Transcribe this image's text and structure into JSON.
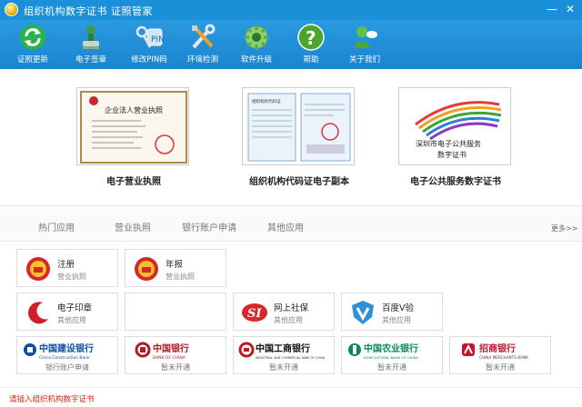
{
  "window": {
    "title": "组织机构数字证书  证照管家",
    "minimize": "—",
    "close": "✕"
  },
  "toolbar": {
    "items": [
      {
        "label": "证照更新",
        "icon": "refresh-icon"
      },
      {
        "label": "电子签章",
        "icon": "seal-stamp-icon"
      },
      {
        "label": "修改PIN码",
        "icon": "key-icon"
      },
      {
        "label": "环境检测",
        "icon": "tools-icon"
      },
      {
        "label": "软件升级",
        "icon": "upgrade-icon"
      },
      {
        "label": "帮助",
        "icon": "help-icon"
      },
      {
        "label": "关于我们",
        "icon": "user-icon"
      }
    ]
  },
  "cards": [
    {
      "caption": "电子营业执照",
      "doc_heading": "企业法人营业执照"
    },
    {
      "caption": "组织机构代码证电子副本",
      "doc_heading": "组织机构代码证"
    },
    {
      "caption": "电子公共服务数字证书",
      "doc_text_1": "深圳市电子公共服务",
      "doc_text_2": "数字证书"
    }
  ],
  "tabs": [
    "热门应用",
    "营业执照",
    "银行账户申请",
    "其他应用"
  ],
  "more": "更多>>",
  "services": {
    "row1": [
      {
        "name": "注册",
        "sub": "营业执照",
        "icon": "national-emblem-icon"
      },
      {
        "name": "年报",
        "sub": "营业执照",
        "icon": "national-emblem-icon"
      }
    ],
    "row2": [
      {
        "name": "电子印章",
        "sub": "其他应用",
        "icon": "e-seal-icon"
      },
      {
        "name": "",
        "sub": ""
      },
      {
        "name": "网上社保",
        "sub": "其他应用",
        "icon": "social-security-icon"
      },
      {
        "name": "百度V验",
        "sub": "其他应用",
        "icon": "baidu-v-icon"
      }
    ],
    "banks": [
      {
        "name": "中国建设银行",
        "en": "China Construction Bank",
        "sub": "银行账户申请",
        "color": "#0b4fa0"
      },
      {
        "name": "中国银行",
        "en": "BANK OF CHINA",
        "sub": "暂未开通",
        "color": "#b01c24"
      },
      {
        "name": "中国工商银行",
        "en": "INDUSTRIAL AND COMMERCIAL BANK OF CHINA",
        "sub": "暂未开通",
        "color": "#c3161c"
      },
      {
        "name": "中国农业银行",
        "en": "AGRICULTURAL BANK OF CHINA",
        "sub": "暂未开通",
        "color": "#0a8a5a"
      },
      {
        "name": "招商银行",
        "en": "CHINA MERCHANTS BANK",
        "sub": "暂未开通",
        "color": "#c8102e"
      }
    ]
  },
  "status": {
    "text": "请插入组织机构数字证书"
  },
  "colors": {
    "titlebar": "#1b8fd8",
    "toolbar": "#1a85cf",
    "status_text": "#dd2211"
  }
}
